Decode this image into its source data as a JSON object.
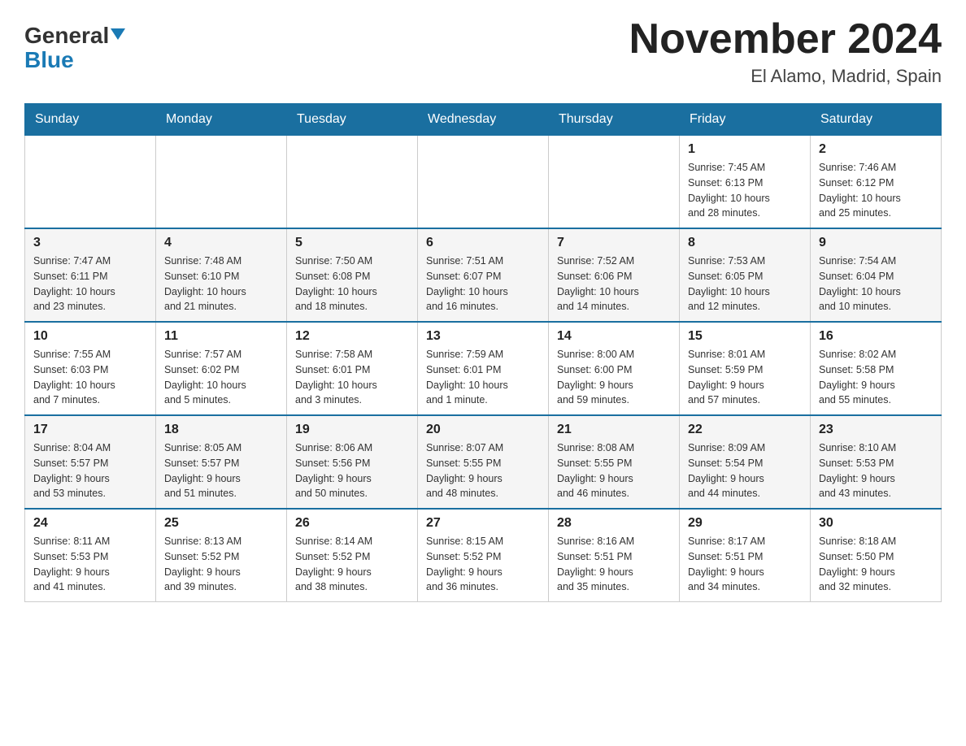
{
  "header": {
    "logo_general": "General",
    "logo_blue": "Blue",
    "month_title": "November 2024",
    "location": "El Alamo, Madrid, Spain"
  },
  "weekdays": [
    "Sunday",
    "Monday",
    "Tuesday",
    "Wednesday",
    "Thursday",
    "Friday",
    "Saturday"
  ],
  "weeks": [
    [
      {
        "day": "",
        "info": ""
      },
      {
        "day": "",
        "info": ""
      },
      {
        "day": "",
        "info": ""
      },
      {
        "day": "",
        "info": ""
      },
      {
        "day": "",
        "info": ""
      },
      {
        "day": "1",
        "info": "Sunrise: 7:45 AM\nSunset: 6:13 PM\nDaylight: 10 hours\nand 28 minutes."
      },
      {
        "day": "2",
        "info": "Sunrise: 7:46 AM\nSunset: 6:12 PM\nDaylight: 10 hours\nand 25 minutes."
      }
    ],
    [
      {
        "day": "3",
        "info": "Sunrise: 7:47 AM\nSunset: 6:11 PM\nDaylight: 10 hours\nand 23 minutes."
      },
      {
        "day": "4",
        "info": "Sunrise: 7:48 AM\nSunset: 6:10 PM\nDaylight: 10 hours\nand 21 minutes."
      },
      {
        "day": "5",
        "info": "Sunrise: 7:50 AM\nSunset: 6:08 PM\nDaylight: 10 hours\nand 18 minutes."
      },
      {
        "day": "6",
        "info": "Sunrise: 7:51 AM\nSunset: 6:07 PM\nDaylight: 10 hours\nand 16 minutes."
      },
      {
        "day": "7",
        "info": "Sunrise: 7:52 AM\nSunset: 6:06 PM\nDaylight: 10 hours\nand 14 minutes."
      },
      {
        "day": "8",
        "info": "Sunrise: 7:53 AM\nSunset: 6:05 PM\nDaylight: 10 hours\nand 12 minutes."
      },
      {
        "day": "9",
        "info": "Sunrise: 7:54 AM\nSunset: 6:04 PM\nDaylight: 10 hours\nand 10 minutes."
      }
    ],
    [
      {
        "day": "10",
        "info": "Sunrise: 7:55 AM\nSunset: 6:03 PM\nDaylight: 10 hours\nand 7 minutes."
      },
      {
        "day": "11",
        "info": "Sunrise: 7:57 AM\nSunset: 6:02 PM\nDaylight: 10 hours\nand 5 minutes."
      },
      {
        "day": "12",
        "info": "Sunrise: 7:58 AM\nSunset: 6:01 PM\nDaylight: 10 hours\nand 3 minutes."
      },
      {
        "day": "13",
        "info": "Sunrise: 7:59 AM\nSunset: 6:01 PM\nDaylight: 10 hours\nand 1 minute."
      },
      {
        "day": "14",
        "info": "Sunrise: 8:00 AM\nSunset: 6:00 PM\nDaylight: 9 hours\nand 59 minutes."
      },
      {
        "day": "15",
        "info": "Sunrise: 8:01 AM\nSunset: 5:59 PM\nDaylight: 9 hours\nand 57 minutes."
      },
      {
        "day": "16",
        "info": "Sunrise: 8:02 AM\nSunset: 5:58 PM\nDaylight: 9 hours\nand 55 minutes."
      }
    ],
    [
      {
        "day": "17",
        "info": "Sunrise: 8:04 AM\nSunset: 5:57 PM\nDaylight: 9 hours\nand 53 minutes."
      },
      {
        "day": "18",
        "info": "Sunrise: 8:05 AM\nSunset: 5:57 PM\nDaylight: 9 hours\nand 51 minutes."
      },
      {
        "day": "19",
        "info": "Sunrise: 8:06 AM\nSunset: 5:56 PM\nDaylight: 9 hours\nand 50 minutes."
      },
      {
        "day": "20",
        "info": "Sunrise: 8:07 AM\nSunset: 5:55 PM\nDaylight: 9 hours\nand 48 minutes."
      },
      {
        "day": "21",
        "info": "Sunrise: 8:08 AM\nSunset: 5:55 PM\nDaylight: 9 hours\nand 46 minutes."
      },
      {
        "day": "22",
        "info": "Sunrise: 8:09 AM\nSunset: 5:54 PM\nDaylight: 9 hours\nand 44 minutes."
      },
      {
        "day": "23",
        "info": "Sunrise: 8:10 AM\nSunset: 5:53 PM\nDaylight: 9 hours\nand 43 minutes."
      }
    ],
    [
      {
        "day": "24",
        "info": "Sunrise: 8:11 AM\nSunset: 5:53 PM\nDaylight: 9 hours\nand 41 minutes."
      },
      {
        "day": "25",
        "info": "Sunrise: 8:13 AM\nSunset: 5:52 PM\nDaylight: 9 hours\nand 39 minutes."
      },
      {
        "day": "26",
        "info": "Sunrise: 8:14 AM\nSunset: 5:52 PM\nDaylight: 9 hours\nand 38 minutes."
      },
      {
        "day": "27",
        "info": "Sunrise: 8:15 AM\nSunset: 5:52 PM\nDaylight: 9 hours\nand 36 minutes."
      },
      {
        "day": "28",
        "info": "Sunrise: 8:16 AM\nSunset: 5:51 PM\nDaylight: 9 hours\nand 35 minutes."
      },
      {
        "day": "29",
        "info": "Sunrise: 8:17 AM\nSunset: 5:51 PM\nDaylight: 9 hours\nand 34 minutes."
      },
      {
        "day": "30",
        "info": "Sunrise: 8:18 AM\nSunset: 5:50 PM\nDaylight: 9 hours\nand 32 minutes."
      }
    ]
  ]
}
